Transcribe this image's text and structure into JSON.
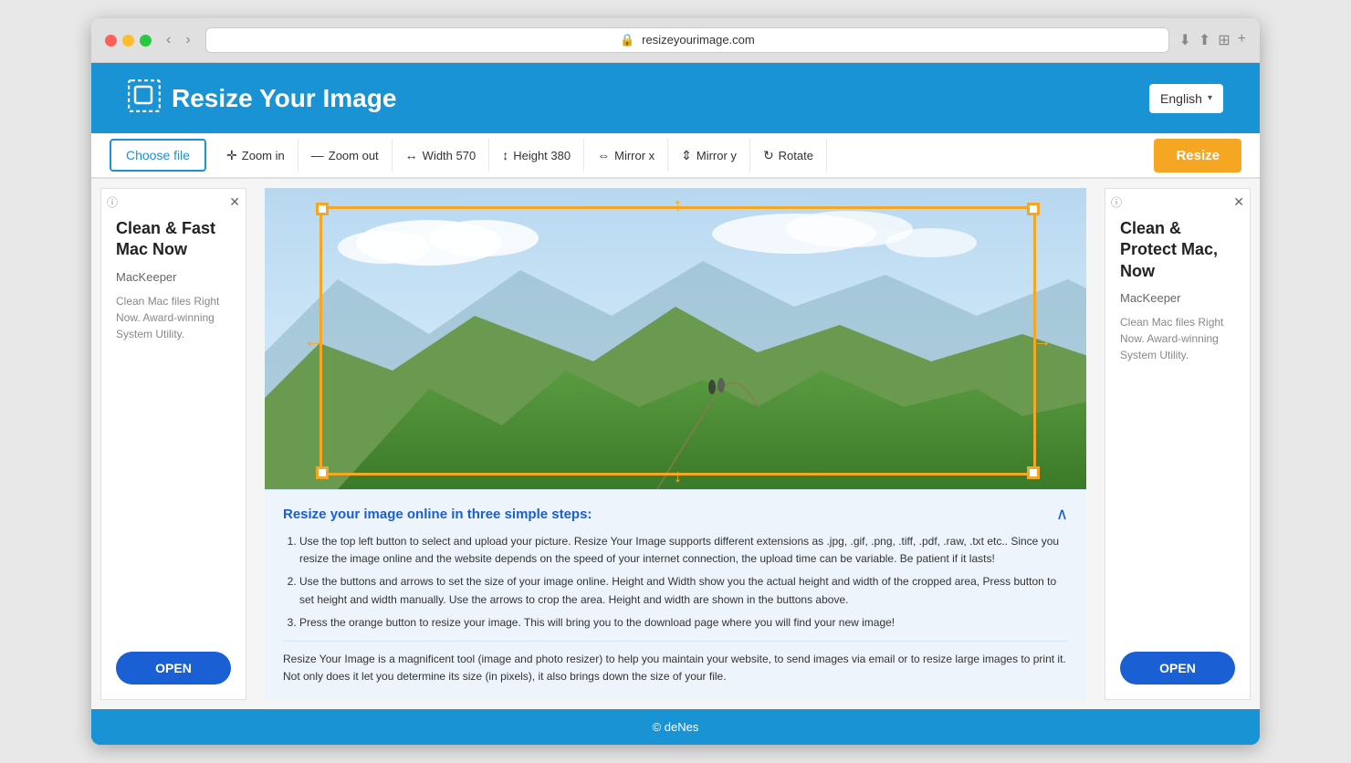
{
  "browser": {
    "url": "resizeyourimage.com"
  },
  "header": {
    "title": "Resize Your Image",
    "logo_alt": "resize-logo"
  },
  "language": {
    "current": "English",
    "arrow": "▾"
  },
  "toolbar": {
    "choose_file": "Choose file",
    "zoom_in": "Zoom in",
    "zoom_out": "Zoom out",
    "width": "Width 570",
    "height": "Height 380",
    "mirror_x": "Mirror x",
    "mirror_y": "Mirror y",
    "rotate": "Rotate",
    "resize": "Resize"
  },
  "ad_left": {
    "headline": "Clean & Fast Mac Now",
    "brand": "MacKeeper",
    "body": "Clean Mac files Right Now. Award-winning System Utility.",
    "open_btn": "OPEN"
  },
  "ad_right": {
    "headline": "Clean & Protect Mac, Now",
    "brand": "MacKeeper",
    "body": "Clean Mac files Right Now. Award-winning System Utility.",
    "open_btn": "OPEN"
  },
  "info": {
    "title": "Resize your image online in three simple steps:",
    "steps": [
      "Use the top left button to select and upload your picture. Resize Your Image supports different extensions as .jpg, .gif, .png, .tiff, .pdf, .raw, .txt etc.. Since you resize the image online and the website depends on the speed of your internet connection, the upload time can be variable. Be patient if it lasts!",
      "Use the buttons and arrows to set the size of your image online. Height and Width show you the actual height and width of the cropped area, Press button to set height and width manually. Use the arrows to crop the area. Height and width are shown in the buttons above.",
      "Press the orange button to resize your image. This will bring you to the download page where you will find your new image!"
    ],
    "footer_text": "Resize Your Image is a magnificent tool (image and photo resizer) to help you maintain your website, to send images via email or to resize large images to print it. Not only does it let you determine its size (in pixels), it also brings down the size of your file."
  },
  "footer": {
    "copyright": "© deNes"
  }
}
